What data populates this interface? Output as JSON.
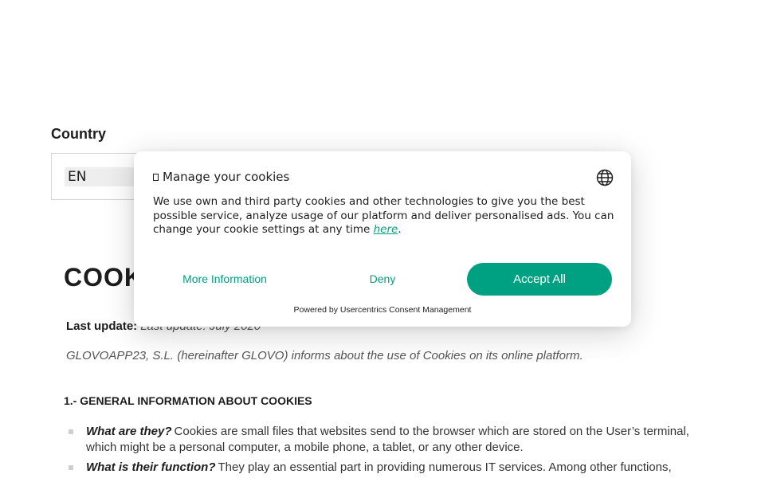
{
  "page": {
    "country_label": "Country",
    "language_value": "EN",
    "title": "COOKIES POLICY",
    "last_update_label": "Last update:",
    "last_update_value": "Last update: July 2020",
    "intro": "GLOVOAPP23, S.L. (hereinafter GLOVO) informs about the use of Cookies on its online platform.",
    "section_heading": "1.- GENERAL INFORMATION ABOUT COOKIES",
    "bullets": [
      {
        "question": "What are they?",
        "text": "Cookies are small files that websites send to the browser which are stored on the User’s terminal, which might be a personal computer, a mobile phone, a tablet, or any other device."
      },
      {
        "question": "What is their function?",
        "text": "They play an essential part in providing numerous IT services. Among other functions,"
      }
    ]
  },
  "cookie_modal": {
    "title": "Manage your cookies",
    "language_icon": "globe-icon",
    "body_text": "We use own and third party cookies and other technologies to give you the best possible service, analyze usage of our platform and deliver personalised ads. You can change your cookie settings at any time",
    "link_text": "here",
    "more_info_label": "More Information",
    "deny_label": "Deny",
    "accept_label": "Accept All",
    "powered_by": "Powered by Usercentrics Consent Management"
  },
  "colors": {
    "accent": "#00a082",
    "text": "#1d1d1d"
  }
}
